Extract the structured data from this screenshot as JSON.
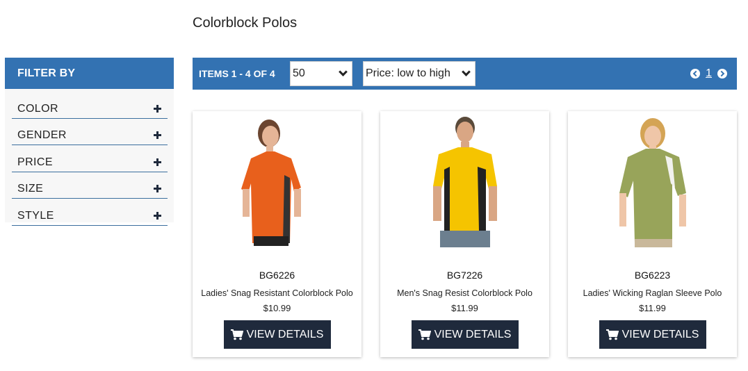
{
  "page": {
    "title": "Colorblock Polos"
  },
  "sidebar": {
    "header": "FILTER BY",
    "items": [
      {
        "label": "COLOR"
      },
      {
        "label": "GENDER"
      },
      {
        "label": "PRICE"
      },
      {
        "label": "SIZE"
      },
      {
        "label": "STYLE"
      }
    ]
  },
  "toolbar": {
    "items_count": "ITEMS 1 - 4 OF 4",
    "per_page": "50",
    "sort": "Price: low to high",
    "page": "1"
  },
  "products": [
    {
      "sku": "BG6226",
      "name": "Ladies' Snag Resistant Colorblock Polo",
      "price": "$10.99",
      "button": "VIEW DETAILS",
      "shirt_color": "#e8601c",
      "panel_color": "#333333"
    },
    {
      "sku": "BG7226",
      "name": "Men's Snag Resist Colorblock Polo",
      "price": "$11.99",
      "button": "VIEW DETAILS",
      "shirt_color": "#f5c400",
      "panel_color": "#222222"
    },
    {
      "sku": "BG6223",
      "name": "Ladies' Wicking Raglan Sleeve Polo",
      "price": "$11.99",
      "button": "VIEW DETAILS",
      "shirt_color": "#98a45a",
      "panel_color": "#f2f2ee"
    }
  ],
  "colors": {
    "primary": "#3372b2",
    "button": "#1f2a3c"
  }
}
